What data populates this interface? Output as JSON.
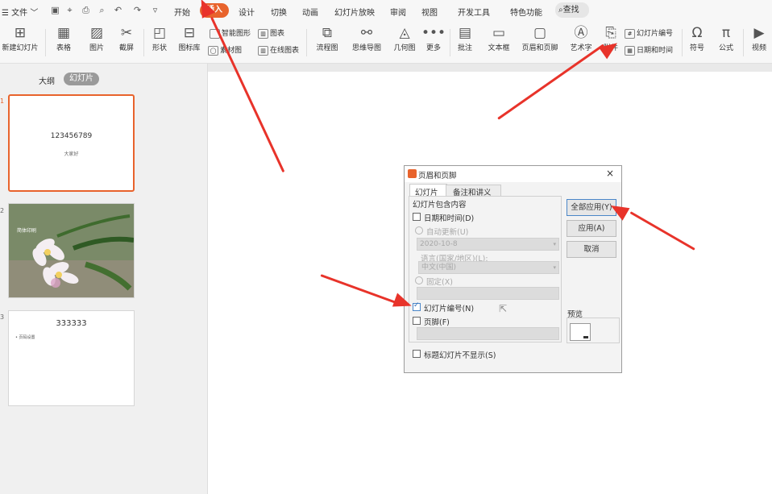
{
  "menubar": {
    "file": "文件",
    "tabs": [
      "开始",
      "插入",
      "设计",
      "切换",
      "动画",
      "幻灯片放映",
      "审阅",
      "视图",
      "开发工具",
      "特色功能"
    ],
    "search": "查找"
  },
  "ribbon": {
    "new_slide": "新建幻灯片",
    "table": "表格",
    "picture": "图片",
    "screenshot": "截屏",
    "shape": "形状",
    "icon_lib": "图标库",
    "smart_graphic": "智能图形",
    "chart": "图表",
    "material": "素材图",
    "online_chart": "在线图表",
    "flowchart": "流程图",
    "mindmap": "思维导图",
    "geometry": "几何图",
    "more": "更多",
    "comment": "批注",
    "textbox": "文本框",
    "header_footer": "页眉和页脚",
    "wordart": "艺术字",
    "attach": "附件",
    "slide_number": "幻灯片编号",
    "datetime": "日期和时间",
    "symbol": "符号",
    "formula": "公式",
    "video": "视频"
  },
  "panel": {
    "tab_outline": "大纲",
    "tab_slides": "幻灯片",
    "slides": [
      {
        "num": "1",
        "title": "123456789",
        "sub": "大家好"
      },
      {
        "num": "2",
        "caption": "简体印刷"
      },
      {
        "num": "3",
        "title": "333333",
        "bullet": "页码设置"
      }
    ]
  },
  "dialog": {
    "title": "页眉和页脚",
    "tab_slide": "幻灯片",
    "tab_notes": "备注和讲义",
    "group": "幻灯片包含内容",
    "datetime": "日期和时间(D)",
    "auto_update": "自动更新(U)",
    "date_value": "2020-10-8",
    "language_label": "语言(国家/地区)(L):",
    "language_value": "中文(中国)",
    "fixed": "固定(X)",
    "slide_number": "幻灯片编号(N)",
    "footer": "页脚(F)",
    "title_hide": "标题幻灯片不显示(S)",
    "apply_all": "全部应用(Y)",
    "apply": "应用(A)",
    "cancel": "取消",
    "preview": "预览",
    "slide_number_checked": true
  },
  "colors": {
    "accent": "#e8632c",
    "arrow": "#e8332a"
  }
}
